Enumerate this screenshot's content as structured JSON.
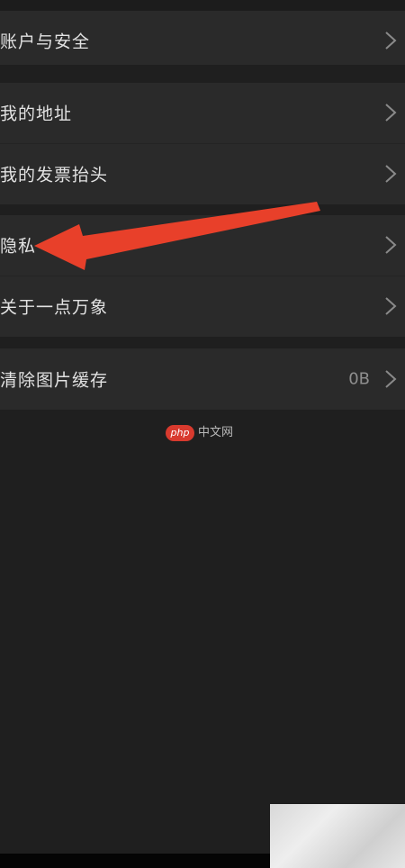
{
  "settings": {
    "items": [
      {
        "label": "账户与安全",
        "icon": "chevron-right-icon"
      },
      {
        "label": "我的地址",
        "icon": "chevron-right-icon"
      },
      {
        "label": "我的发票抬头",
        "icon": "chevron-right-icon"
      },
      {
        "label": "隐私",
        "icon": "chevron-right-icon"
      },
      {
        "label": "关于一点万象",
        "icon": "chevron-right-icon"
      },
      {
        "label": "清除图片缓存",
        "value": "0B",
        "icon": "chevron-right-icon"
      }
    ]
  },
  "watermark": {
    "badge": "php",
    "text": "中文网"
  },
  "annotation": {
    "icon": "red-arrow-icon",
    "color": "#e8402a"
  },
  "colors": {
    "background": "#1f1f1f",
    "row_background": "#2a2a2a",
    "text": "#e2e2e2",
    "secondary_text": "#8f8f8f"
  }
}
